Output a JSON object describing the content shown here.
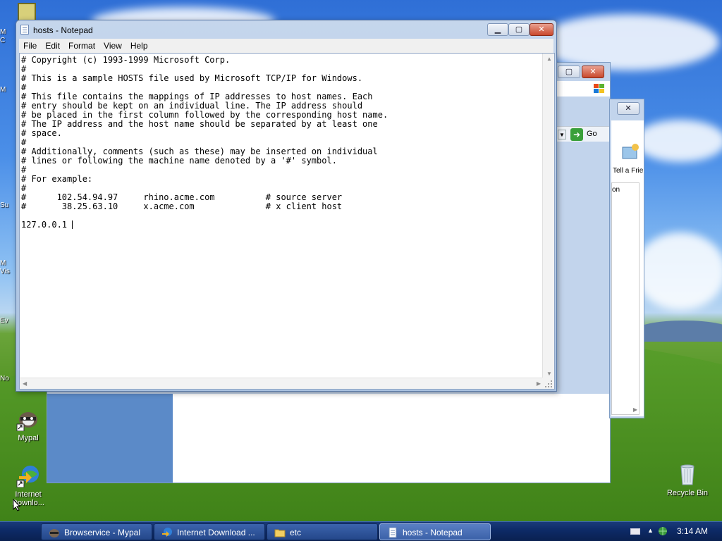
{
  "notepad": {
    "title": "hosts - Notepad",
    "menu": [
      "File",
      "Edit",
      "Format",
      "View",
      "Help"
    ],
    "content": "# Copyright (c) 1993-1999 Microsoft Corp.\n#\n# This is a sample HOSTS file used by Microsoft TCP/IP for Windows.\n#\n# This file contains the mappings of IP addresses to host names. Each\n# entry should be kept on an individual line. The IP address should\n# be placed in the first column followed by the corresponding host name.\n# The IP address and the host name should be separated by at least one\n# space.\n#\n# Additionally, comments (such as these) may be inserted on individual\n# lines or following the machine name denoted by a '#' symbol.\n#\n# For example:\n#\n#      102.54.94.97     rhino.acme.com          # source server\n#       38.25.63.10     x.acme.com              # x client host\n\n127.0.0.1 ",
    "minimize": "▁",
    "maximize": "▢",
    "close": "✕"
  },
  "background_windows": {
    "go_label": "Go",
    "tell_a_friend": "Tell a Frie",
    "column_fragment": "on"
  },
  "desktop_icons": {
    "mypal": "Mypal",
    "internet_download": "Internet Downlo...",
    "recycle_bin": "Recycle Bin",
    "left_fragments": [
      "M",
      "C",
      "M",
      "Su",
      "M",
      "Vis",
      "Ev",
      "No"
    ]
  },
  "taskbar": {
    "buttons": [
      {
        "label": "Browservice - Mypal",
        "icon": "raccoon-icon",
        "active": false
      },
      {
        "label": "Internet Download ...",
        "icon": "idm-globe-icon",
        "active": false
      },
      {
        "label": "etc",
        "icon": "folder-icon",
        "active": false
      },
      {
        "label": "hosts - Notepad",
        "icon": "notepad-icon",
        "active": true
      }
    ],
    "clock": "3:14 AM"
  },
  "colors": {
    "taskbar": "#0d2a66",
    "title_glass": "#b7cbe6",
    "close_button": "#c9482c"
  }
}
